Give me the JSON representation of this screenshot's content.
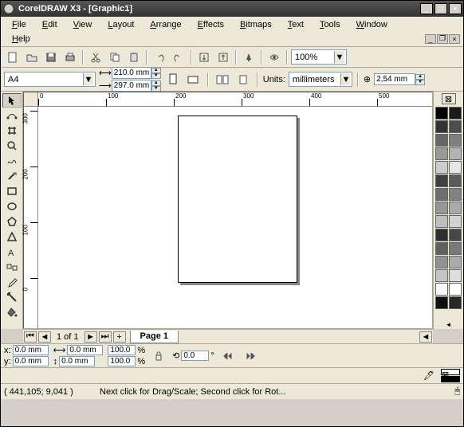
{
  "title": "CorelDRAW X3 - [Graphic1]",
  "menu": [
    "File",
    "Edit",
    "View",
    "Layout",
    "Arrange",
    "Effects",
    "Bitmaps",
    "Text",
    "Tools",
    "Window",
    "Help"
  ],
  "zoom": "100%",
  "paper_size": "A4",
  "width": "210.0 mm",
  "height": "297.0 mm",
  "units_label": "Units:",
  "units": "millimeters",
  "nudge": "2,54 mm",
  "page_nav": "1 of 1",
  "page_tab": "Page 1",
  "status_x": "0.0 mm",
  "status_y": "0.0 mm",
  "status_w": "0.0 mm",
  "status_h": "0.0 mm",
  "scale_x": "100.0",
  "scale_y": "100.0",
  "rotate": "0.0",
  "cursor_pos": "( 441,105; 9,041 )",
  "hint": "Next click for Drag/Scale; Second click for Rot...",
  "ruler_h": [
    "0",
    "100",
    "200",
    "300",
    "400",
    "500"
  ],
  "ruler_h_pos": [
    0,
    85,
    170,
    255,
    340,
    425
  ],
  "ruler_v": [
    "300",
    "200",
    "100",
    "0"
  ],
  "ruler_v_pos": [
    5,
    75,
    145,
    215
  ],
  "palette": [
    "#000000",
    "#1a1a1a",
    "#333333",
    "#4d4d4d",
    "#666666",
    "#7f7f7f",
    "#999999",
    "#b3b3b3",
    "#cccccc",
    "#e6e6e6",
    "#404040",
    "#5a5a5a",
    "#6e6e6e",
    "#828282",
    "#969696",
    "#aaaaaa",
    "#bebebe",
    "#d2d2d2",
    "#2e2e2e",
    "#474747",
    "#606060",
    "#797979",
    "#929292",
    "#ababab",
    "#c4c4c4",
    "#dddddd",
    "#f6f6f6",
    "#ffffff",
    "#0f0f0f",
    "#282828"
  ]
}
